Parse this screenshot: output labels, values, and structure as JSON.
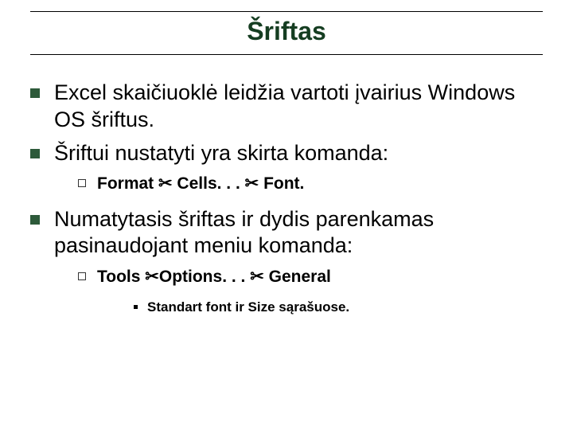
{
  "title": "Šriftas",
  "bullets": {
    "b1": "Excel skaičiuoklė leidžia vartoti įvairius Windows OS šriftus.",
    "b2": "Šriftui nustatyti yra skirta komanda:",
    "b2_sub": "Format ✂ Cells. . . ✂ Font.",
    "b3": "Numatytasis šriftas ir dydis parenkamas pasinaudojant meniu komanda:",
    "b3_sub": "Tools ✂Options. . . ✂ General",
    "b3_sub_sub": "Standart font ir Size sąrašuose."
  }
}
